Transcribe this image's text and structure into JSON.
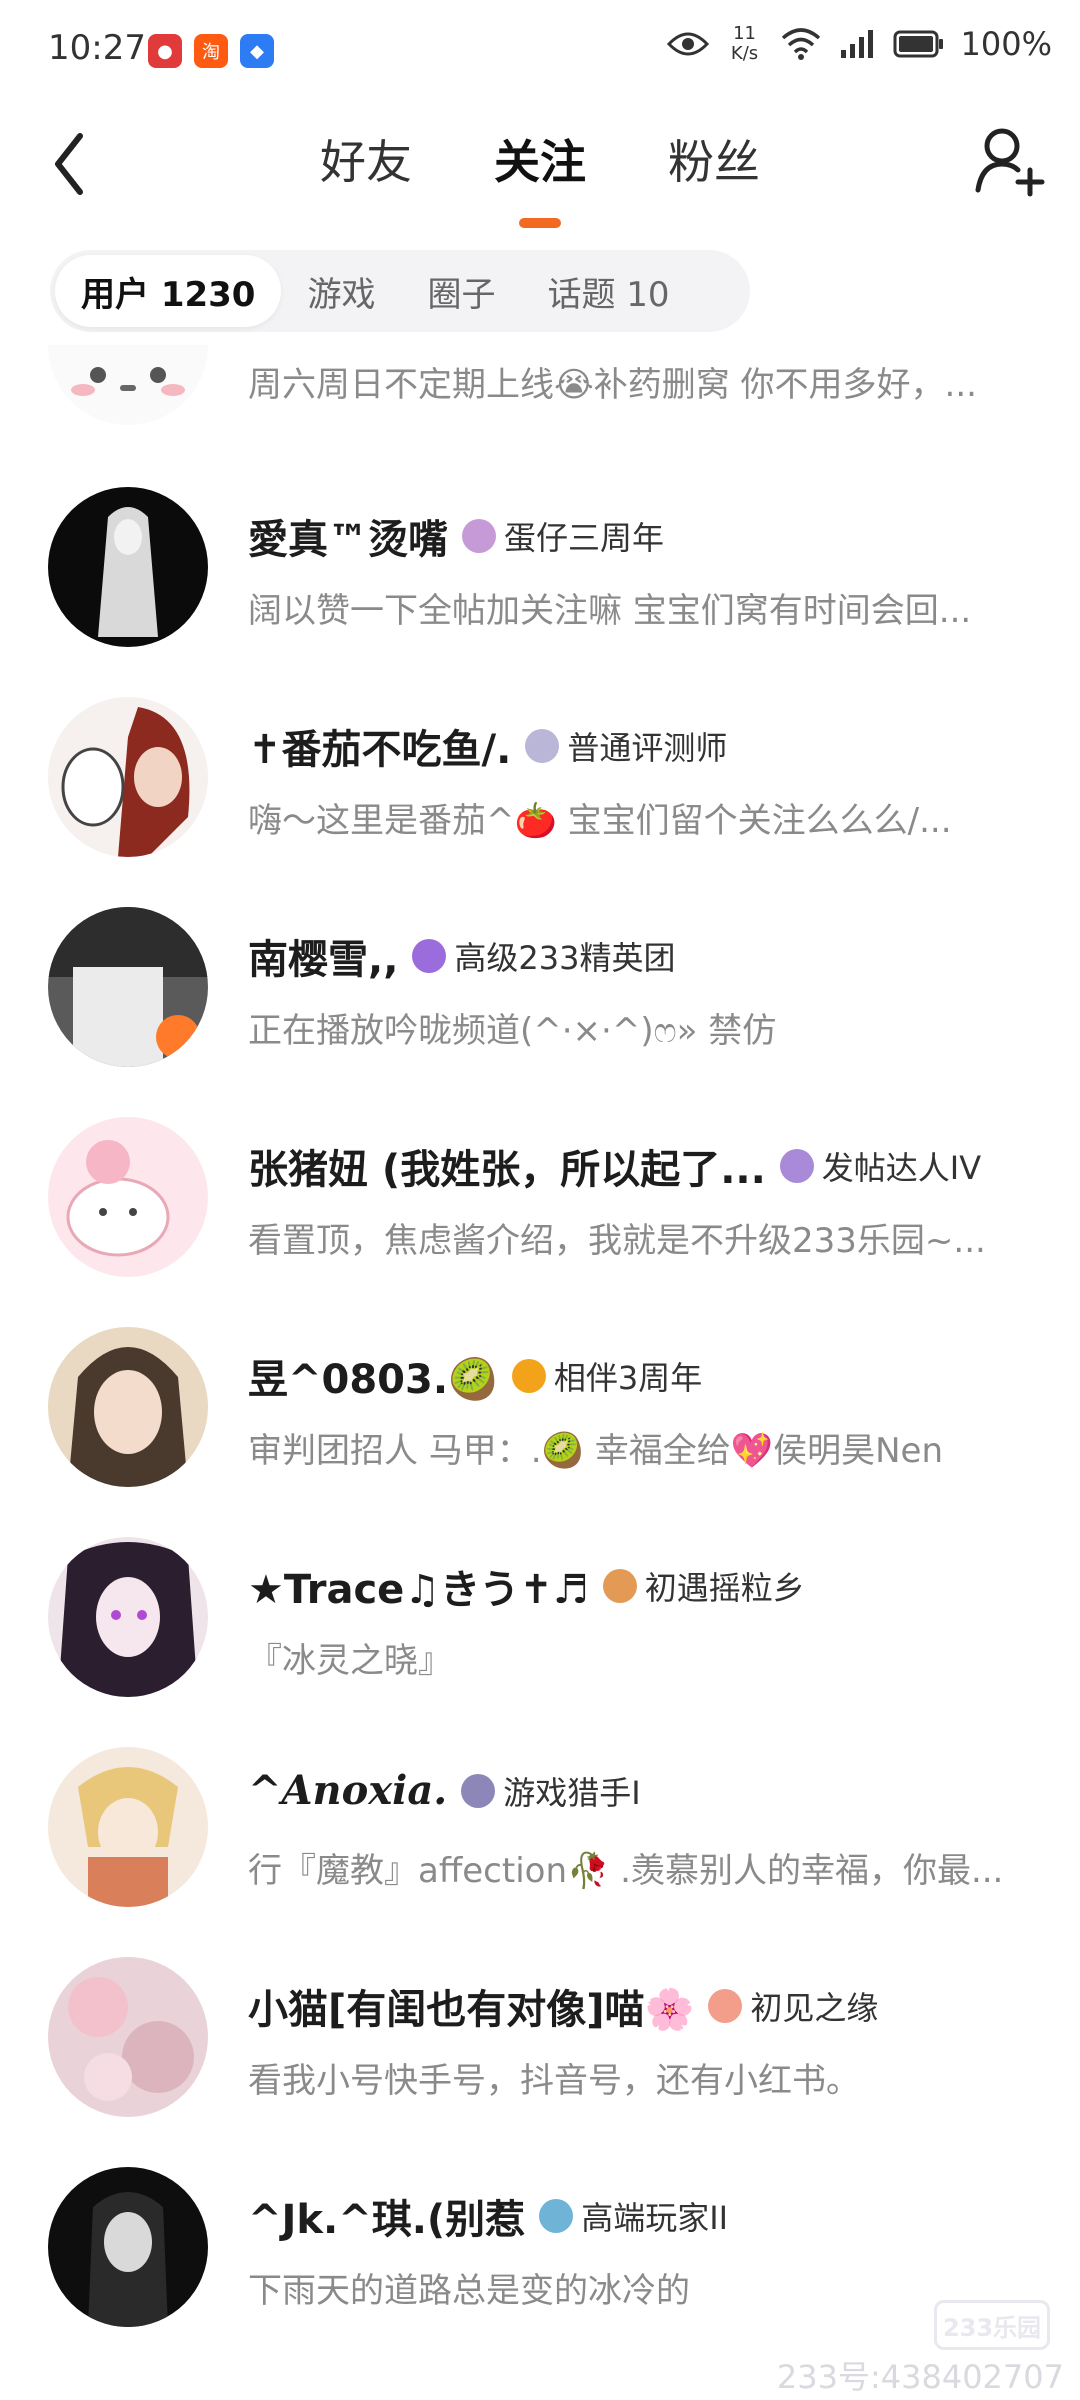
{
  "status_bar": {
    "time": "10:27",
    "speed_value": "11",
    "speed_unit": "K/s",
    "battery": "100%",
    "icons": [
      "eye-icon",
      "wifi-icon",
      "signal-icon",
      "battery-icon"
    ],
    "app_icons": [
      {
        "name": "app-icon-1",
        "color": "#e03a3a"
      },
      {
        "name": "app-icon-taobao",
        "color": "#ff5a12"
      },
      {
        "name": "app-icon-3",
        "color": "#2d7cf3"
      }
    ]
  },
  "header": {
    "tabs": [
      {
        "label": "好友"
      },
      {
        "label": "关注"
      },
      {
        "label": "粉丝"
      }
    ],
    "active_tab": 1,
    "accent_color": "#f26a22"
  },
  "segment": {
    "items": [
      {
        "label": "用户 1230"
      },
      {
        "label": "游戏"
      },
      {
        "label": "圈子"
      },
      {
        "label": "话题 10"
      }
    ]
  },
  "list": [
    {
      "name": "",
      "badge": "",
      "sub": "周六周日不定期上线😭补药删窝 你不用多好，..."
    },
    {
      "name": "愛真™烫嘴",
      "badge": "蛋仔三周年",
      "sub": "阔以赞一下全帖加关注嘛  宝宝们窝有时间会回..."
    },
    {
      "name": "✝番茄不吃鱼/.",
      "badge": "普通评测师",
      "sub": "嗨～这里是番茄^🍅 宝宝们留个关注么么么/..."
    },
    {
      "name": "南樱雪,,",
      "badge": "高级233精英团",
      "sub": "正在播放吟昽频道(^·×·^)ෆ» 禁仿"
    },
    {
      "name": "张猪妞 (我姓张，所以起了...",
      "badge": "发帖达人IV",
      "sub": "看置顶，焦虑酱介绍，我就是不升级233乐园~..."
    },
    {
      "name": "昱^0803.🥝",
      "badge": "相伴3周年",
      "sub": "审判团招人    马甲：.🥝 幸福全给💖侯明昊Nen"
    },
    {
      "name": "★Trace♫きう✝♬",
      "badge": "初遇摇粒乡",
      "sub": "『冰灵之晓』"
    },
    {
      "name": "^Anoxia.",
      "badge": "游戏猎手I",
      "sub": "行『魔教』affection🥀 .羡慕别人的幸福，你最..."
    },
    {
      "name": "小猫[有闺也有对像]喵🌸",
      "badge": "初见之缘",
      "sub": "看我小号快手号，抖音号，还有小红书。"
    },
    {
      "name": "^Jk.^琪.(别惹",
      "badge": "高端玩家II",
      "sub": "下雨天的道路总是变的冰冷的"
    }
  ],
  "watermark": {
    "logo": "233乐园",
    "id": "233号:438402707"
  }
}
